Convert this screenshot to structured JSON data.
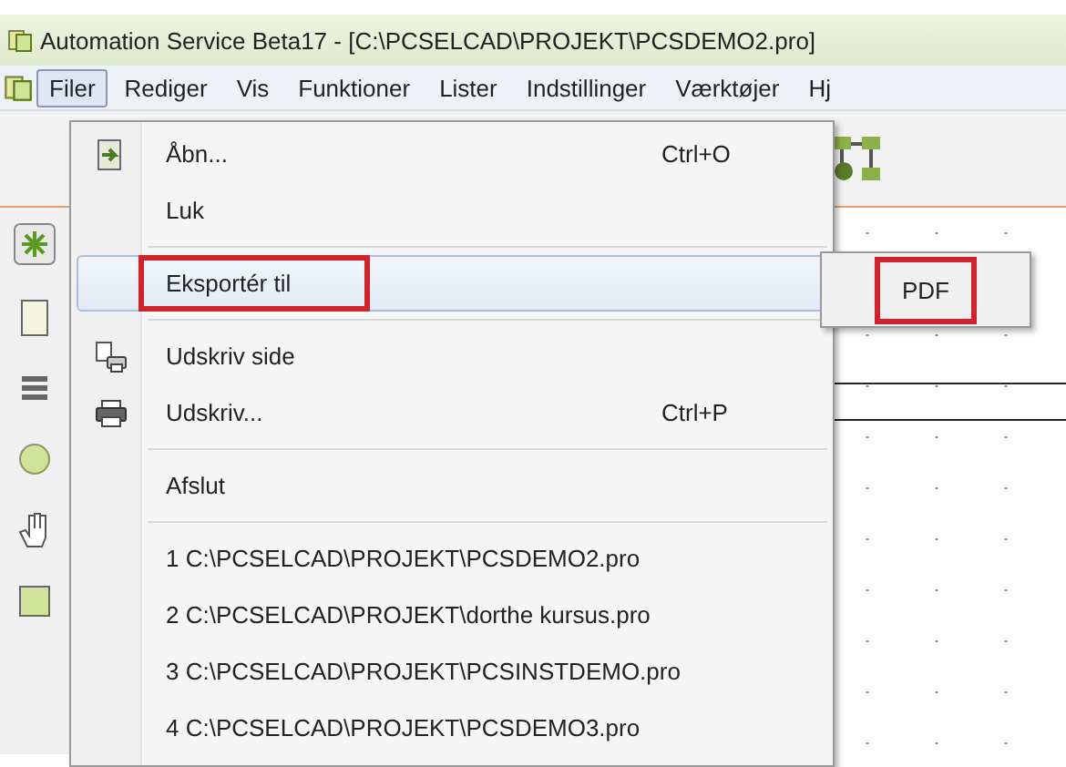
{
  "window": {
    "title": "Automation Service Beta17 - [C:\\PCSELCAD\\PROJEKT\\PCSDEMO2.pro]"
  },
  "menu_bar": [
    {
      "label": "Filer",
      "selected": true
    },
    {
      "label": "Rediger",
      "selected": false
    },
    {
      "label": "Vis",
      "selected": false
    },
    {
      "label": "Funktioner",
      "selected": false
    },
    {
      "label": "Lister",
      "selected": false
    },
    {
      "label": "Indstillinger",
      "selected": false
    },
    {
      "label": "Værktøjer",
      "selected": false
    },
    {
      "label": "Hj",
      "selected": false
    }
  ],
  "file_menu": [
    {
      "kind": "item",
      "label": "Åbn...",
      "shortcut": "Ctrl+O",
      "highlighted": false,
      "annotated": false
    },
    {
      "kind": "item",
      "label": "Luk",
      "highlighted": false,
      "annotated": false
    },
    {
      "kind": "separator"
    },
    {
      "kind": "item",
      "label": "Eksportér til",
      "highlighted": true,
      "annotated": true
    },
    {
      "kind": "separator"
    },
    {
      "kind": "item",
      "label": "Udskriv side",
      "highlighted": false,
      "annotated": false
    },
    {
      "kind": "item",
      "label": "Udskriv...",
      "shortcut": "Ctrl+P",
      "highlighted": false,
      "annotated": false
    },
    {
      "kind": "separator"
    },
    {
      "kind": "item",
      "label": "Afslut",
      "highlighted": false,
      "annotated": false
    },
    {
      "kind": "separator"
    },
    {
      "kind": "item",
      "label": "1 C:\\PCSELCAD\\PROJEKT\\PCSDEMO2.pro",
      "highlighted": false,
      "annotated": false
    },
    {
      "kind": "item",
      "label": "2 C:\\PCSELCAD\\PROJEKT\\dorthe kursus.pro",
      "highlighted": false,
      "annotated": false
    },
    {
      "kind": "item",
      "label": "3 C:\\PCSELCAD\\PROJEKT\\PCSINSTDEMO.pro",
      "highlighted": false,
      "annotated": false
    },
    {
      "kind": "item",
      "label": "4 C:\\PCSELCAD\\PROJEKT\\PCSDEMO3.pro",
      "highlighted": false,
      "annotated": false
    }
  ],
  "submenu": [
    {
      "label": "PDF",
      "annotated": true
    }
  ]
}
